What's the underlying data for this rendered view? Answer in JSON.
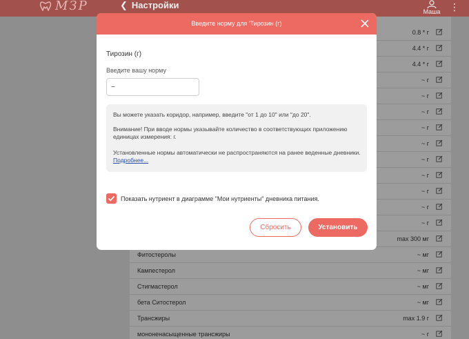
{
  "header": {
    "logo_text": "МЗР",
    "back_label": "Настройки",
    "user_label": "Маша"
  },
  "rows": [
    {
      "name": "",
      "value": "0.8 * г"
    },
    {
      "name": "",
      "value": "4.4 * г"
    },
    {
      "name": "",
      "value": "4.4 * г"
    },
    {
      "name": "",
      "value": "~ г"
    },
    {
      "name": "",
      "value": "~ г"
    },
    {
      "name": "",
      "value": "~ г"
    },
    {
      "name": "",
      "value": "~ г"
    },
    {
      "name": "",
      "value": "~ г"
    },
    {
      "name": "",
      "value": "~ г"
    },
    {
      "name": "",
      "value": "~ г"
    },
    {
      "name": "",
      "value": "~ г"
    },
    {
      "name": "",
      "value": "~ г"
    },
    {
      "name": "",
      "value": "~ г"
    },
    {
      "name": "",
      "value": "max 300 мг"
    },
    {
      "name": "Фитостеролы",
      "value": "~ мг"
    },
    {
      "name": "Кампестерол",
      "value": "~ мг"
    },
    {
      "name": "Стигмастерол",
      "value": "~ мг"
    },
    {
      "name": "бета Ситостерол",
      "value": "~ мг"
    },
    {
      "name": "Трансжиры",
      "value": "max 1.9 г"
    },
    {
      "name": "мононенасыщенные трансжиры",
      "value": "~ г"
    }
  ],
  "modal": {
    "title": "Введите норму для 'Тирозин (г)",
    "nutrient_name": "Тирозин (г)",
    "input_label": "Введите вашу норму",
    "input_value": "~",
    "info_line1": "Вы можете указать коридор, например, введите \"от 1 до 10\" или \"до 20\".",
    "info_line2": "Внимание! При вводе нормы указывайте количество в соответствующих приложению единицах измерения: г.",
    "info_line3": "Установленные нормы автоматически не распространяются на ранее веденные дневники.",
    "info_link": "Подробнее...",
    "checkbox_label": "Показать нутриент в диаграмме \"Мои нутриенты\" дневника питания.",
    "checkbox_checked": true,
    "reset_label": "Сбросить",
    "set_label": "Установить"
  },
  "colors": {
    "accent": "#ec6a62",
    "topbar": "#a3514d",
    "link": "#2b4fa8"
  }
}
